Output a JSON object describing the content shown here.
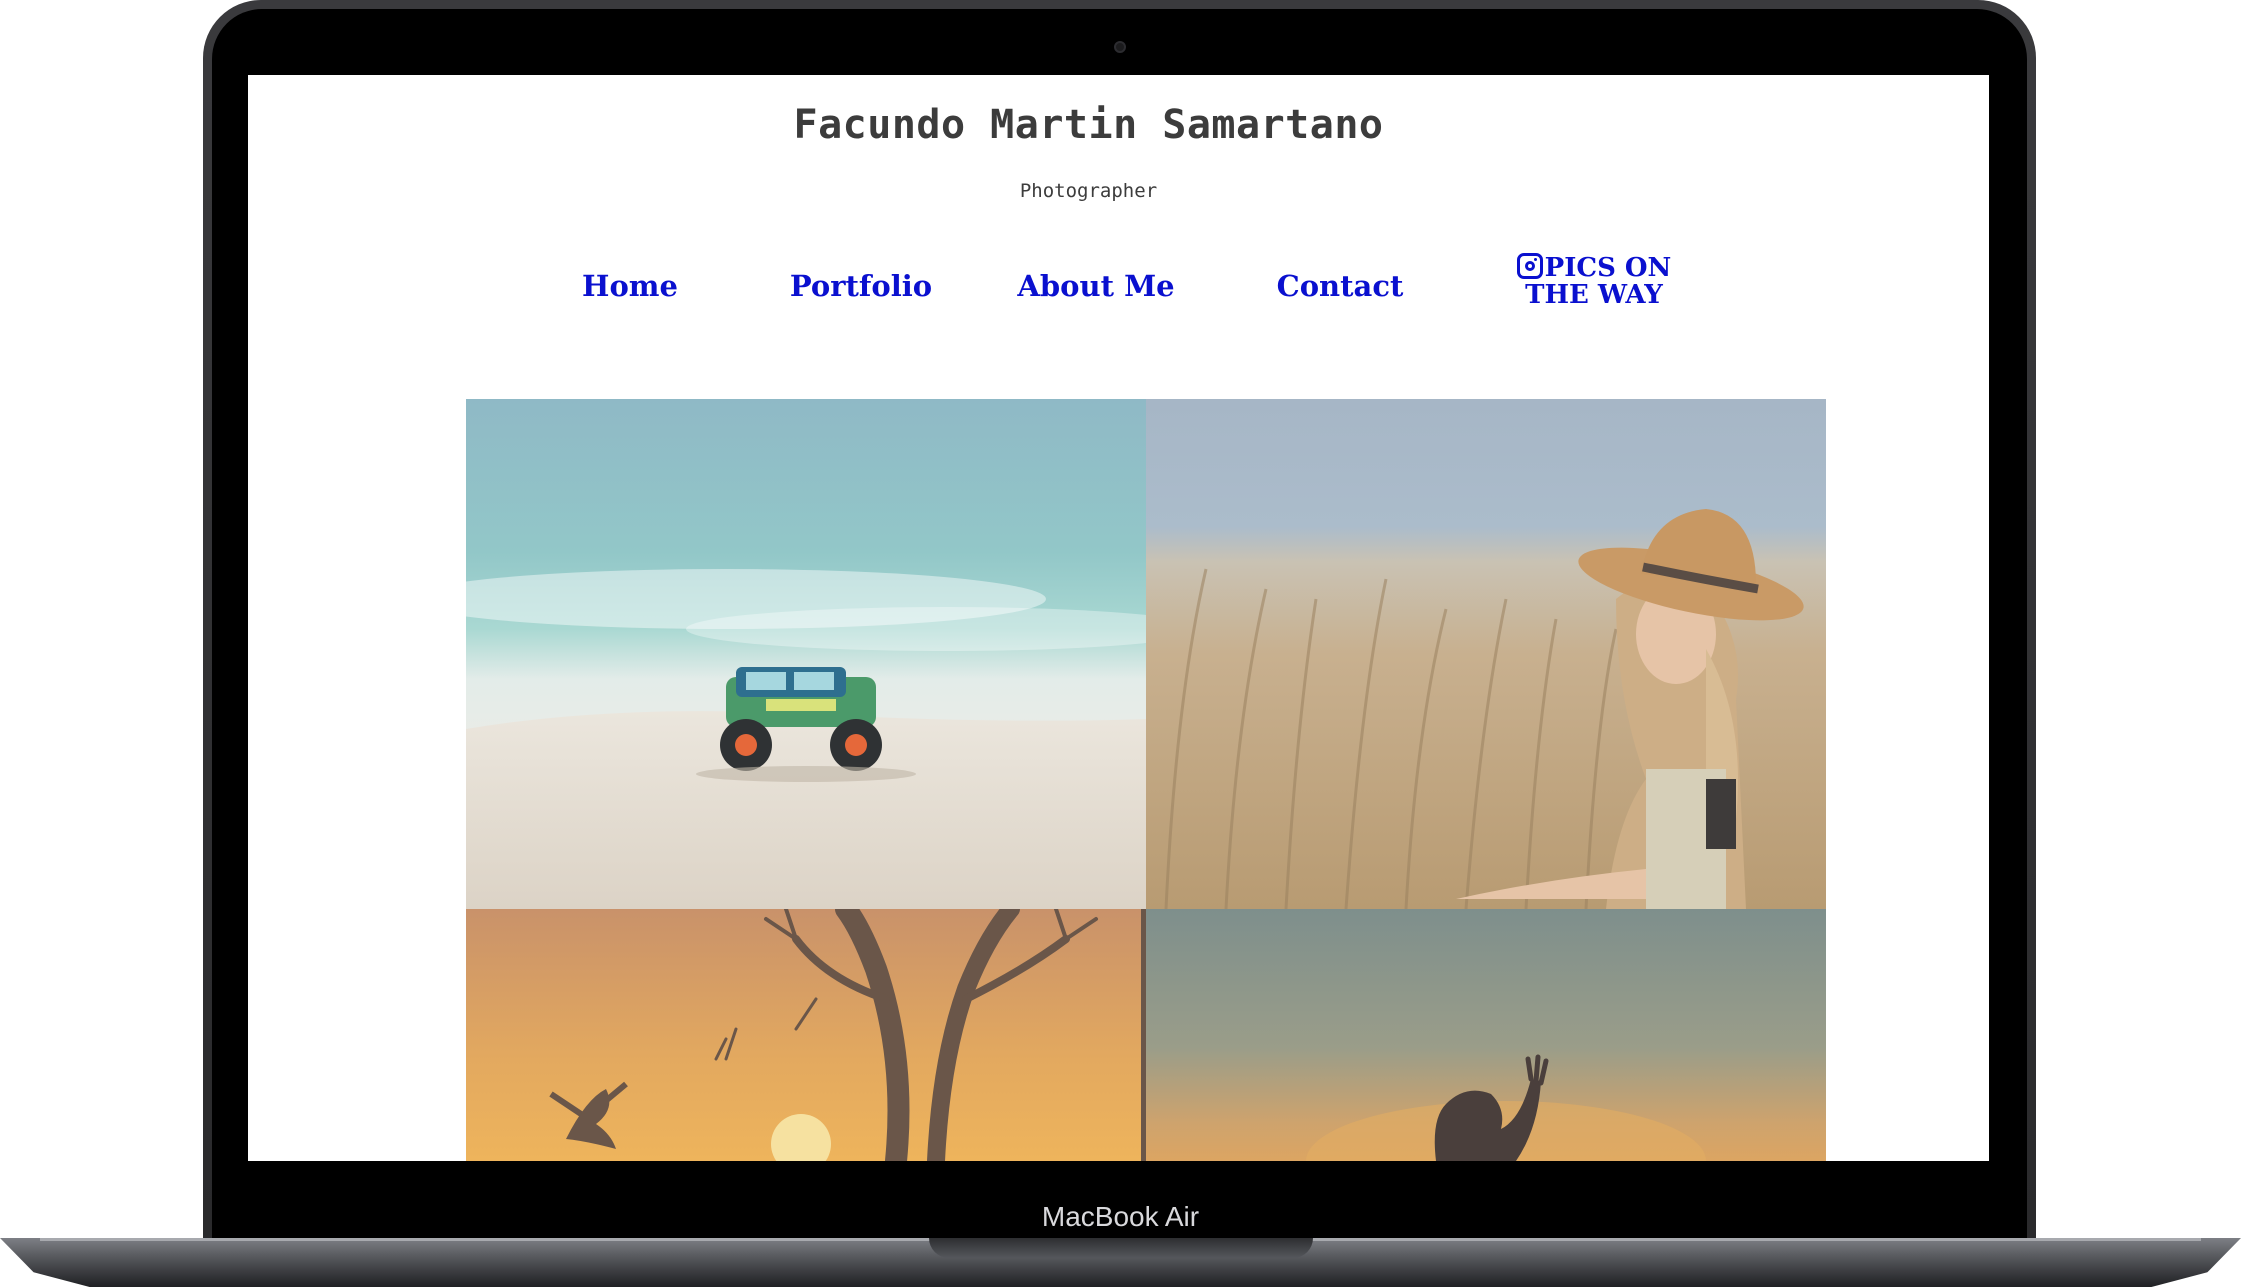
{
  "site": {
    "title": "Facundo Martin Samartano",
    "subtitle": "Photographer"
  },
  "nav": {
    "items": [
      {
        "label": "Home"
      },
      {
        "label": "Portfolio"
      },
      {
        "label": "About Me"
      },
      {
        "label": "Contact"
      }
    ],
    "instagram": {
      "icon": "instagram-icon",
      "line1": "PICS ON",
      "line2": "THE WAY"
    }
  },
  "device": {
    "label": "MacBook Air"
  },
  "colors": {
    "nav_link": "#0a10cf",
    "title_text": "#3c3c3c"
  }
}
